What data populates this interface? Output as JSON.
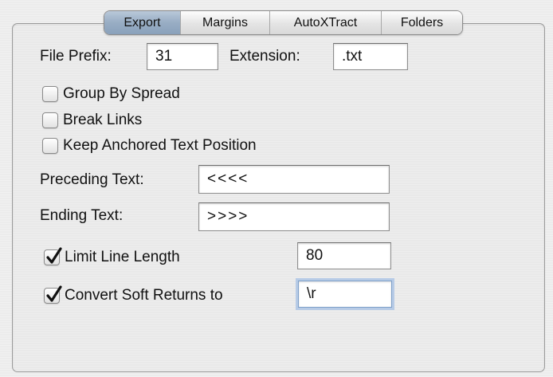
{
  "tabs": [
    {
      "label": "Export",
      "active": true
    },
    {
      "label": "Margins",
      "active": false
    },
    {
      "label": "AutoXTract",
      "active": false
    },
    {
      "label": "Folders",
      "active": false
    }
  ],
  "file_prefix": {
    "label": "File Prefix:",
    "value": "31"
  },
  "extension": {
    "label": "Extension:",
    "value": ".txt"
  },
  "options": {
    "group_by_spread": {
      "label": "Group By Spread",
      "checked": false
    },
    "break_links": {
      "label": "Break Links",
      "checked": false
    },
    "keep_anchored": {
      "label": "Keep Anchored Text Position",
      "checked": false
    }
  },
  "preceding_text": {
    "label": "Preceding Text:",
    "value": "<<<<"
  },
  "ending_text": {
    "label": "Ending Text:",
    "value": ">>>>"
  },
  "limit_line_length": {
    "label": "Limit Line Length",
    "checked": true,
    "value": "80"
  },
  "convert_soft_returns": {
    "label": "Convert Soft Returns to",
    "checked": true,
    "value": "\\r"
  },
  "colors": {
    "active_tab": "#98adc4",
    "focus_ring": "#b7cbe6",
    "panel_bg": "#e9e9e9"
  }
}
